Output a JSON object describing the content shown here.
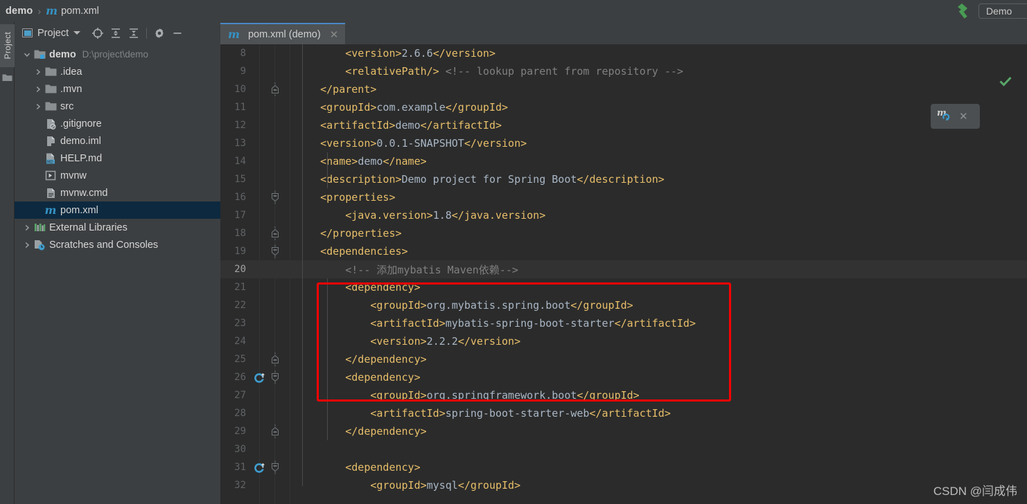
{
  "window": {
    "breadcrumb": {
      "root": "demo",
      "separator": "›",
      "file_icon": "maven-m-icon",
      "file": "pom.xml"
    },
    "run_config": {
      "label": "Demo"
    },
    "build_icon": "hammer-icon",
    "watermark": "CSDN @闫成伟"
  },
  "toolstrip": {
    "tab_label": "Project",
    "folder_icon": "folder-icon"
  },
  "project_panel": {
    "title": "Project",
    "title_icon": "window-icon",
    "dropdown_icon": "chevron-down-icon",
    "toolbar_icons": [
      "locate-target-icon",
      "expand-all-icon",
      "collapse-all-icon",
      "gear-icon",
      "minimize-icon"
    ],
    "tree": [
      {
        "label": "demo",
        "path": "D:\\project\\demo",
        "icon": "module-folder-icon",
        "arrow": "expanded",
        "depth": 0,
        "bold": true,
        "selected": false
      },
      {
        "label": ".idea",
        "path": "",
        "icon": "folder-icon",
        "arrow": "collapsed",
        "depth": 1,
        "bold": false,
        "selected": false
      },
      {
        "label": ".mvn",
        "path": "",
        "icon": "folder-icon",
        "arrow": "collapsed",
        "depth": 1,
        "bold": false,
        "selected": false
      },
      {
        "label": "src",
        "path": "",
        "icon": "folder-icon",
        "arrow": "collapsed",
        "depth": 1,
        "bold": false,
        "selected": false
      },
      {
        "label": ".gitignore",
        "path": "",
        "icon": "gitignore-file-icon",
        "arrow": "none",
        "depth": 1,
        "bold": false,
        "selected": false
      },
      {
        "label": "demo.iml",
        "path": "",
        "icon": "iml-file-icon",
        "arrow": "none",
        "depth": 1,
        "bold": false,
        "selected": false
      },
      {
        "label": "HELP.md",
        "path": "",
        "icon": "markdown-file-icon",
        "arrow": "none",
        "depth": 1,
        "bold": false,
        "selected": false
      },
      {
        "label": "mvnw",
        "path": "",
        "icon": "script-file-icon",
        "arrow": "none",
        "depth": 1,
        "bold": false,
        "selected": false
      },
      {
        "label": "mvnw.cmd",
        "path": "",
        "icon": "cmd-file-icon",
        "arrow": "none",
        "depth": 1,
        "bold": false,
        "selected": false
      },
      {
        "label": "pom.xml",
        "path": "",
        "icon": "maven-m-icon",
        "arrow": "none",
        "depth": 1,
        "bold": false,
        "selected": true
      },
      {
        "label": "External Libraries",
        "path": "",
        "icon": "libraries-icon",
        "arrow": "collapsed",
        "depth": 0,
        "bold": false,
        "selected": false
      },
      {
        "label": "Scratches and Consoles",
        "path": "",
        "icon": "scratches-icon",
        "arrow": "collapsed",
        "depth": 0,
        "bold": false,
        "selected": false
      }
    ]
  },
  "editor": {
    "tab": {
      "label": "pom.xml (demo)",
      "icon": "maven-m-icon",
      "close_icon": "close-icon"
    },
    "inspection_status_icon": "green-check-icon",
    "first_line_number": 8,
    "lines": [
      {
        "n": 8,
        "indent": 8,
        "fold": "",
        "gutter": "",
        "current": false,
        "spans": [
          {
            "c": "tag",
            "t": "<version>"
          },
          {
            "c": "txt",
            "t": "2.6.6"
          },
          {
            "c": "tag",
            "t": "</version>"
          }
        ]
      },
      {
        "n": 9,
        "indent": 8,
        "fold": "",
        "gutter": "",
        "current": false,
        "spans": [
          {
            "c": "tag",
            "t": "<relativePath/>"
          },
          {
            "c": "cmt",
            "t": " <!-- lookup parent from repository -->"
          }
        ]
      },
      {
        "n": 10,
        "indent": 4,
        "fold": "end",
        "gutter": "",
        "current": false,
        "spans": [
          {
            "c": "tag",
            "t": "</parent>"
          }
        ]
      },
      {
        "n": 11,
        "indent": 4,
        "fold": "",
        "gutter": "",
        "current": false,
        "spans": [
          {
            "c": "tag",
            "t": "<groupId>"
          },
          {
            "c": "txt",
            "t": "com.example"
          },
          {
            "c": "tag",
            "t": "</groupId>"
          }
        ]
      },
      {
        "n": 12,
        "indent": 4,
        "fold": "",
        "gutter": "",
        "current": false,
        "spans": [
          {
            "c": "tag",
            "t": "<artifactId>"
          },
          {
            "c": "txt",
            "t": "demo"
          },
          {
            "c": "tag",
            "t": "</artifactId>"
          }
        ]
      },
      {
        "n": 13,
        "indent": 4,
        "fold": "",
        "gutter": "",
        "current": false,
        "spans": [
          {
            "c": "tag",
            "t": "<version>"
          },
          {
            "c": "txt",
            "t": "0.0.1-SNAPSHOT"
          },
          {
            "c": "tag",
            "t": "</version>"
          }
        ]
      },
      {
        "n": 14,
        "indent": 4,
        "fold": "",
        "gutter": "",
        "current": false,
        "spans": [
          {
            "c": "tag",
            "t": "<name>"
          },
          {
            "c": "txt",
            "t": "demo"
          },
          {
            "c": "tag",
            "t": "</name>"
          }
        ]
      },
      {
        "n": 15,
        "indent": 4,
        "fold": "",
        "gutter": "",
        "current": false,
        "spans": [
          {
            "c": "tag",
            "t": "<description>"
          },
          {
            "c": "txt",
            "t": "Demo project for Spring Boot"
          },
          {
            "c": "tag",
            "t": "</description>"
          }
        ]
      },
      {
        "n": 16,
        "indent": 4,
        "fold": "start",
        "gutter": "",
        "current": false,
        "spans": [
          {
            "c": "tag",
            "t": "<properties>"
          }
        ]
      },
      {
        "n": 17,
        "indent": 8,
        "fold": "",
        "gutter": "",
        "current": false,
        "spans": [
          {
            "c": "tag",
            "t": "<java.version>"
          },
          {
            "c": "txt",
            "t": "1.8"
          },
          {
            "c": "tag",
            "t": "</java.version>"
          }
        ]
      },
      {
        "n": 18,
        "indent": 4,
        "fold": "end",
        "gutter": "",
        "current": false,
        "spans": [
          {
            "c": "tag",
            "t": "</properties>"
          }
        ]
      },
      {
        "n": 19,
        "indent": 4,
        "fold": "start",
        "gutter": "",
        "current": false,
        "spans": [
          {
            "c": "tag",
            "t": "<dependencies>"
          }
        ]
      },
      {
        "n": 20,
        "indent": 8,
        "fold": "",
        "gutter": "",
        "current": true,
        "spans": [
          {
            "c": "cmt",
            "t": "<!-- 添加mybatis Maven依赖-->"
          }
        ]
      },
      {
        "n": 21,
        "indent": 8,
        "fold": "",
        "gutter": "",
        "current": false,
        "spans": [
          {
            "c": "tag",
            "t": "<dependency>"
          }
        ]
      },
      {
        "n": 22,
        "indent": 12,
        "fold": "",
        "gutter": "",
        "current": false,
        "spans": [
          {
            "c": "tag",
            "t": "<groupId>"
          },
          {
            "c": "txt",
            "t": "org.mybatis.spring.boot"
          },
          {
            "c": "tag",
            "t": "</groupId>"
          }
        ]
      },
      {
        "n": 23,
        "indent": 12,
        "fold": "",
        "gutter": "",
        "current": false,
        "spans": [
          {
            "c": "tag",
            "t": "<artifactId>"
          },
          {
            "c": "txt",
            "t": "mybatis-spring-boot-starter"
          },
          {
            "c": "tag",
            "t": "</artifactId>"
          }
        ]
      },
      {
        "n": 24,
        "indent": 12,
        "fold": "",
        "gutter": "",
        "current": false,
        "spans": [
          {
            "c": "tag",
            "t": "<version>"
          },
          {
            "c": "txt",
            "t": "2.2.2"
          },
          {
            "c": "tag",
            "t": "</version>"
          }
        ]
      },
      {
        "n": 25,
        "indent": 8,
        "fold": "end",
        "gutter": "",
        "current": false,
        "spans": [
          {
            "c": "tag",
            "t": "</dependency>"
          }
        ]
      },
      {
        "n": 26,
        "indent": 8,
        "fold": "start",
        "gutter": "maven-dependency-icon",
        "current": false,
        "spans": [
          {
            "c": "tag",
            "t": "<dependency>"
          }
        ]
      },
      {
        "n": 27,
        "indent": 12,
        "fold": "",
        "gutter": "",
        "current": false,
        "spans": [
          {
            "c": "tag",
            "t": "<groupId>"
          },
          {
            "c": "txt",
            "t": "org.springframework.boot"
          },
          {
            "c": "tag",
            "t": "</groupId>"
          }
        ]
      },
      {
        "n": 28,
        "indent": 12,
        "fold": "",
        "gutter": "",
        "current": false,
        "spans": [
          {
            "c": "tag",
            "t": "<artifactId>"
          },
          {
            "c": "txt",
            "t": "spring-boot-starter-web"
          },
          {
            "c": "tag",
            "t": "</artifactId>"
          }
        ]
      },
      {
        "n": 29,
        "indent": 8,
        "fold": "end",
        "gutter": "",
        "current": false,
        "spans": [
          {
            "c": "tag",
            "t": "</dependency>"
          }
        ]
      },
      {
        "n": 30,
        "indent": 0,
        "fold": "",
        "gutter": "",
        "current": false,
        "spans": []
      },
      {
        "n": 31,
        "indent": 8,
        "fold": "start",
        "gutter": "maven-dependency-icon",
        "current": false,
        "spans": [
          {
            "c": "tag",
            "t": "<dependency>"
          }
        ]
      },
      {
        "n": 32,
        "indent": 12,
        "fold": "",
        "gutter": "",
        "current": false,
        "spans": [
          {
            "c": "tag",
            "t": "<groupId>"
          },
          {
            "c": "txt",
            "t": "mysql"
          },
          {
            "c": "tag",
            "t": "</groupId>"
          }
        ]
      }
    ]
  },
  "annotation": {
    "type": "red-rectangle-highlight",
    "color": "#fe0000",
    "covers_lines": [
      20,
      25
    ]
  },
  "maven_popup": {
    "icon": "maven-reload-icon",
    "close_icon": "close-icon"
  }
}
